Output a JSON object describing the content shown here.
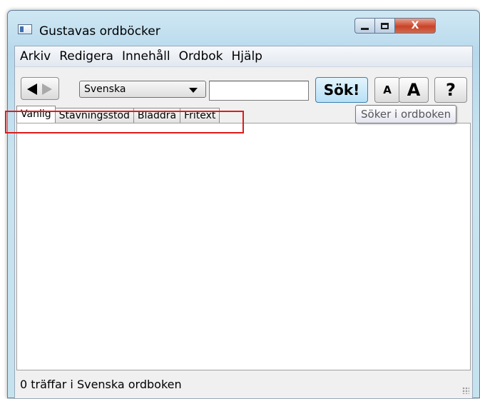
{
  "window": {
    "title": "Gustavas ordböcker",
    "close_label": "X"
  },
  "menu": [
    "Arkiv",
    "Redigera",
    "Innehåll",
    "Ordbok",
    "Hjälp"
  ],
  "toolbar": {
    "language_selected": "Svenska",
    "search_value": "",
    "search_button": "Sök!",
    "font_small_label": "A",
    "font_large_label": "A",
    "help_label": "?"
  },
  "tabs": [
    "Vanlig",
    "Stavningsstöd",
    "Bläddra",
    "Fritext"
  ],
  "active_tab": "Vanlig",
  "tooltip": "Söker i ordboken",
  "status": "0 träffar i Svenska ordboken",
  "colors": {
    "highlight": "#e01b1b",
    "close_button": "#c8442a",
    "search_button": "#b7e0f6"
  }
}
